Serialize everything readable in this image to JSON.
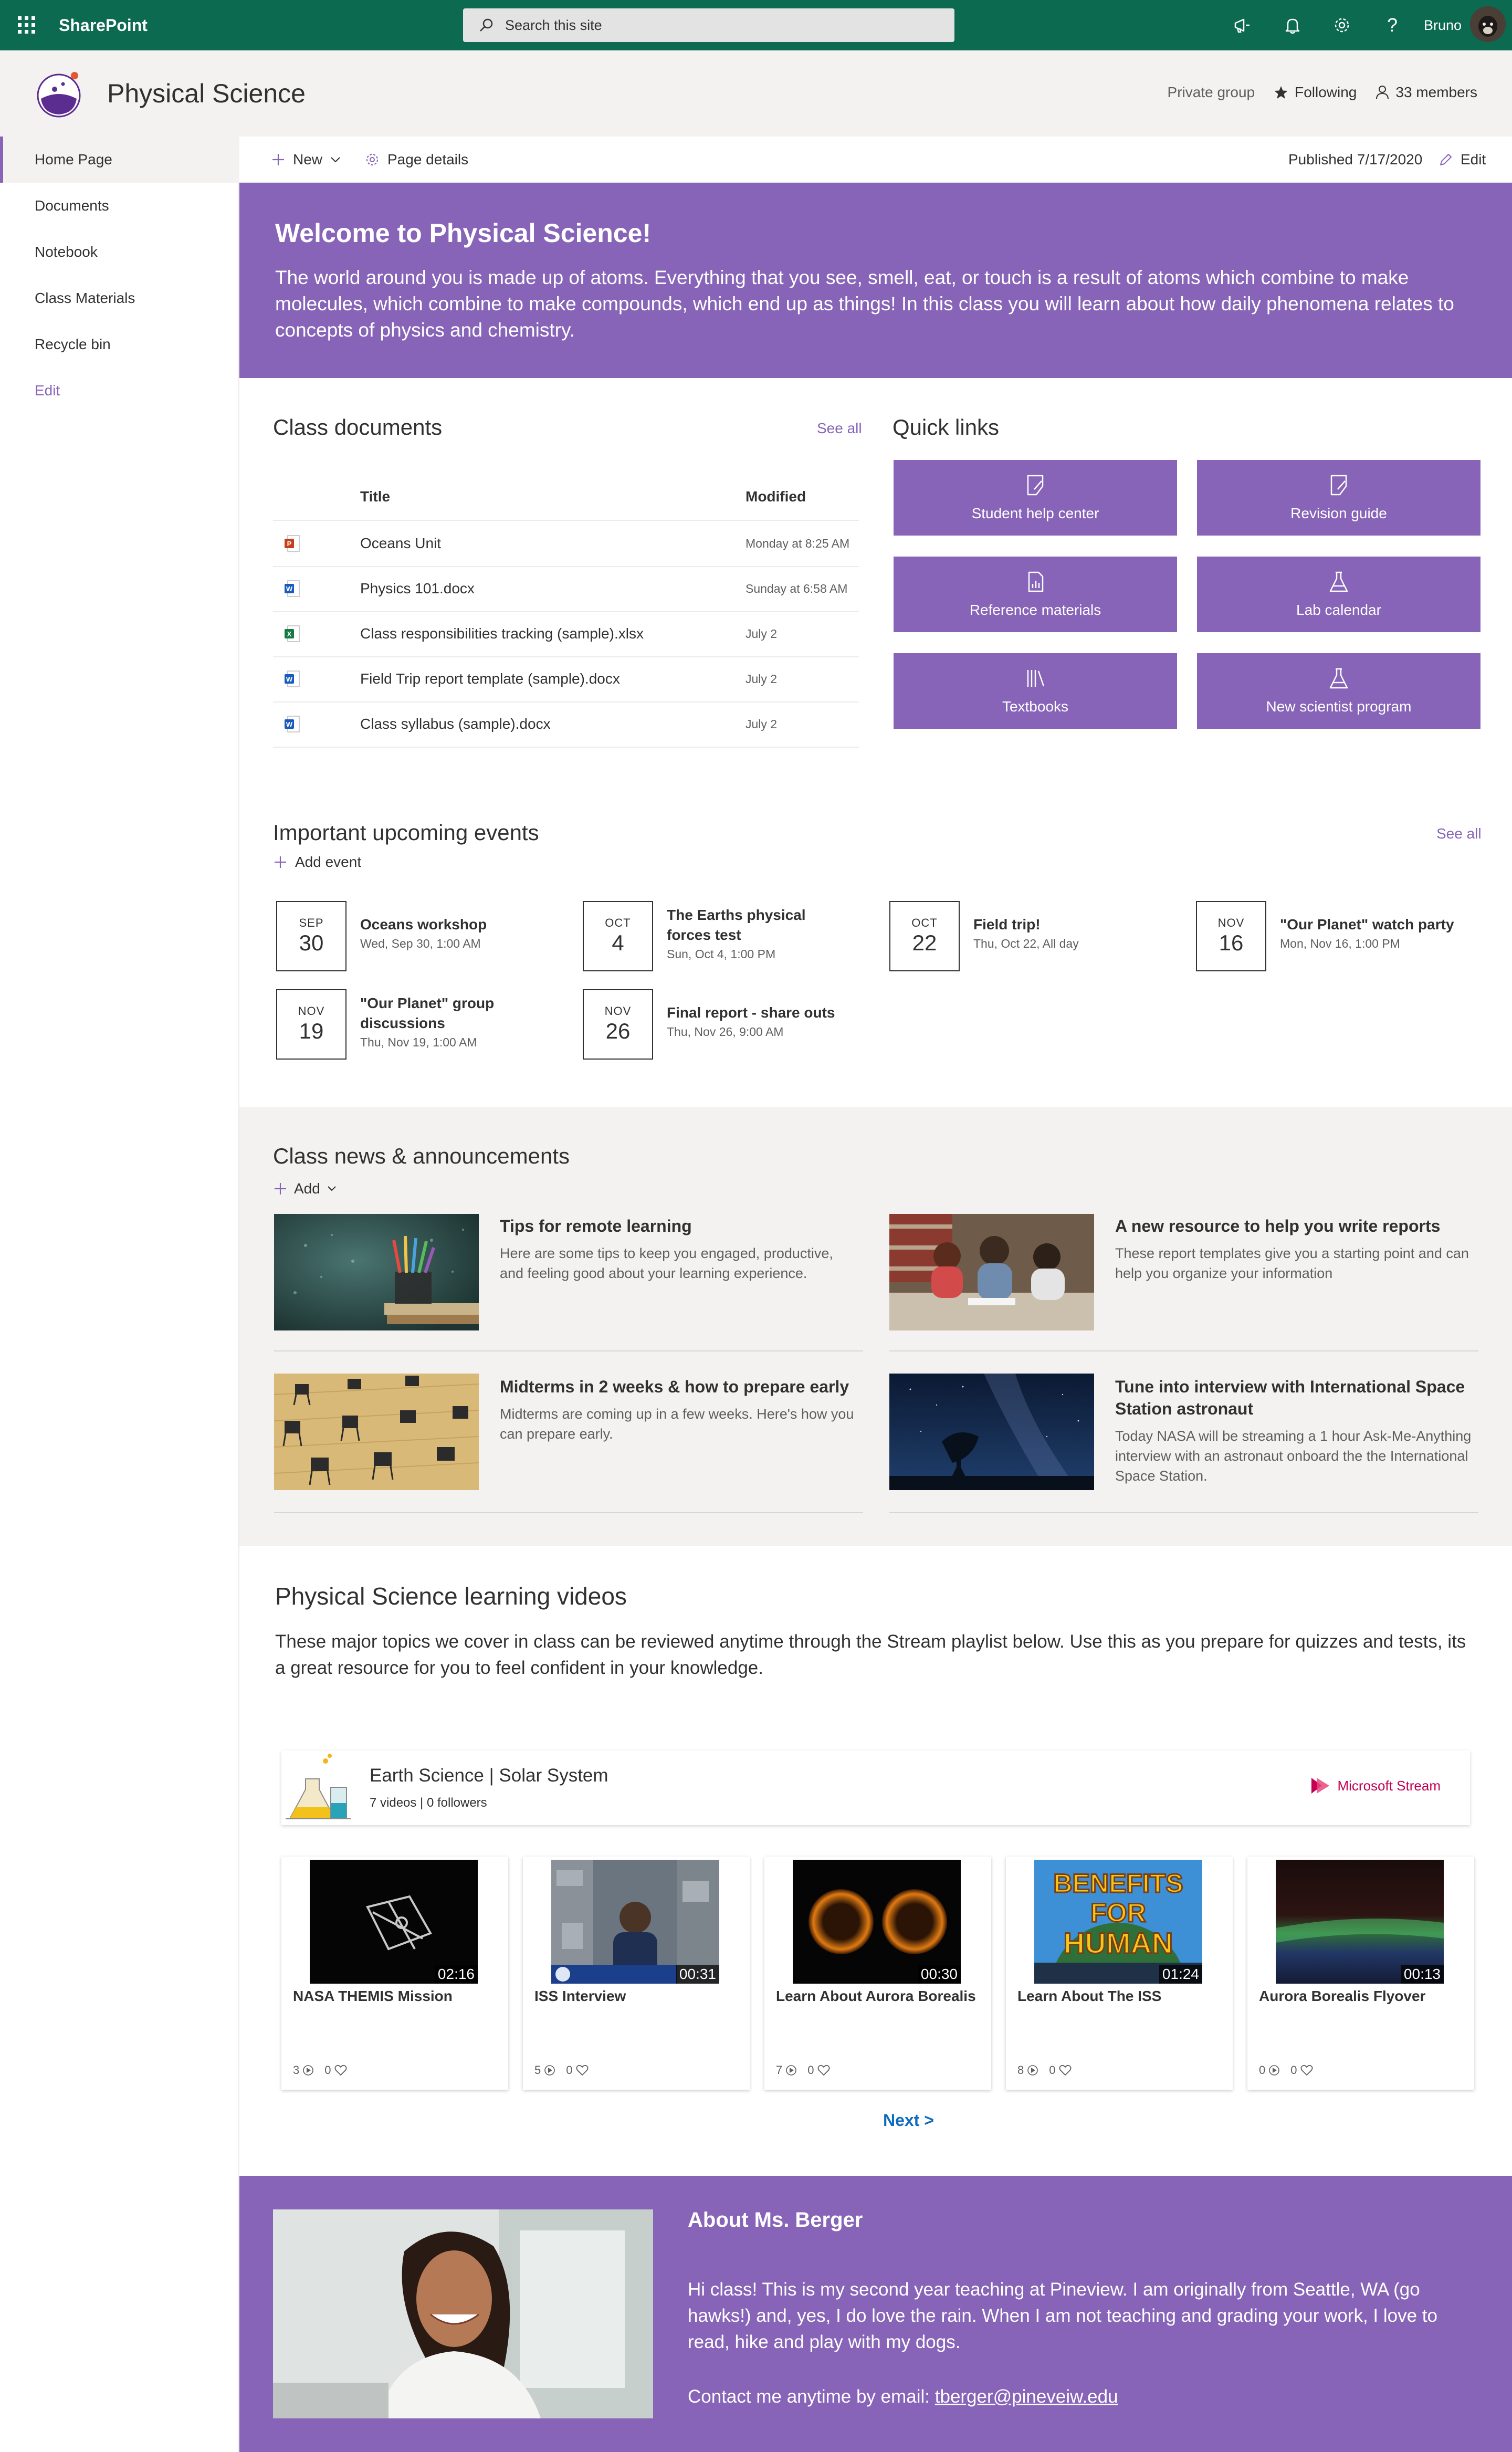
{
  "suite": {
    "app_name": "SharePoint",
    "search_placeholder": "Search this site",
    "user_name": "Bruno"
  },
  "site": {
    "title": "Physical Science",
    "privacy": "Private group",
    "following_label": "Following",
    "members_label": "33 members"
  },
  "nav": {
    "items": [
      {
        "label": "Home Page"
      },
      {
        "label": "Documents"
      },
      {
        "label": "Notebook"
      },
      {
        "label": "Class Materials"
      },
      {
        "label": "Recycle bin"
      }
    ],
    "edit_label": "Edit"
  },
  "commandbar": {
    "new_label": "New",
    "page_details_label": "Page details",
    "published_label": "Published 7/17/2020",
    "edit_label": "Edit"
  },
  "hero": {
    "title": "Welcome to Physical Science!",
    "body": "The world around you is made up of atoms. Everything that you see, smell, eat, or touch is a result of atoms which combine to make molecules, which combine to make compounds, which end up as things! In this class you will learn about how daily phenomena relates to concepts of physics and chemistry."
  },
  "documents": {
    "title": "Class documents",
    "see_all": "See all",
    "col_title": "Title",
    "col_modified": "Modified",
    "rows": [
      {
        "type": "pptx",
        "title": "Oceans Unit",
        "modified": "Monday at 8:25 AM"
      },
      {
        "type": "docx",
        "title": "Physics 101.docx",
        "modified": "Sunday at 6:58 AM"
      },
      {
        "type": "xlsx",
        "title": "Class responsibilities tracking (sample).xlsx",
        "modified": "July 2"
      },
      {
        "type": "docx",
        "title": "Field Trip report template (sample).docx",
        "modified": "July 2"
      },
      {
        "type": "docx",
        "title": "Class syllabus (sample).docx",
        "modified": "July 2"
      }
    ],
    "colors": {
      "pptx": "#c43e1c",
      "docx": "#185abd",
      "xlsx": "#107c41"
    }
  },
  "quicklinks": {
    "title": "Quick links",
    "items": [
      {
        "label": "Student help center",
        "icon": "edit-page-icon"
      },
      {
        "label": "Revision guide",
        "icon": "edit-page-icon"
      },
      {
        "label": "Reference materials",
        "icon": "report-document-icon"
      },
      {
        "label": "Lab calendar",
        "icon": "beaker-icon"
      },
      {
        "label": "Textbooks",
        "icon": "library-icon"
      },
      {
        "label": "New scientist program",
        "icon": "beaker-icon"
      }
    ]
  },
  "events": {
    "title": "Important upcoming events",
    "see_all": "See all",
    "add_label": "Add event",
    "items": [
      {
        "month": "SEP",
        "day": "30",
        "title": "Oceans workshop",
        "time": "Wed, Sep 30, 1:00 AM"
      },
      {
        "month": "OCT",
        "day": "4",
        "title": "The Earths physical forces test",
        "time": "Sun, Oct 4, 1:00 PM"
      },
      {
        "month": "OCT",
        "day": "22",
        "title": "Field trip!",
        "time": "Thu, Oct 22, All day"
      },
      {
        "month": "NOV",
        "day": "16",
        "title": "\"Our Planet\" watch party",
        "time": "Mon, Nov 16, 1:00 PM"
      },
      {
        "month": "NOV",
        "day": "19",
        "title": "\"Our Planet\" group discussions",
        "time": "Thu, Nov 19, 1:00 AM"
      },
      {
        "month": "NOV",
        "day": "26",
        "title": "Final report - share outs",
        "time": "Thu, Nov 26, 9:00 AM"
      }
    ]
  },
  "news": {
    "title": "Class news & announcements",
    "add_label": "Add",
    "items": [
      {
        "title": "Tips for remote learning",
        "desc": "Here are some tips to keep you engaged, productive, and feeling good about your learning experience."
      },
      {
        "title": "A new resource to help you write reports",
        "desc": "These report templates give you a starting point and can help you organize your information"
      },
      {
        "title": "Midterms in 2 weeks & how to prepare early",
        "desc": "Midterms are coming up in a few weeks. Here's how you can prepare early."
      },
      {
        "title": "Tune into interview with International Space Station astronaut",
        "desc": "Today NASA will be streaming a 1 hour Ask-Me-Anything interview with an astronaut onboard the the International Space Station."
      }
    ]
  },
  "videos": {
    "title": "Physical Science learning videos",
    "body": "These major topics we cover in class can be reviewed anytime through the Stream playlist below. Use this as you prepare for quizzes and tests, its a great resource for you to feel confident in your knowledge.",
    "playlist_title": "Earth Science | Solar System",
    "playlist_meta": "7 videos | 0 followers",
    "stream_label": "Microsoft Stream",
    "items": [
      {
        "title": "NASA THEMIS Mission",
        "duration": "02:16",
        "views": "3",
        "likes": "0"
      },
      {
        "title": "ISS Interview",
        "duration": "00:31",
        "views": "5",
        "likes": "0"
      },
      {
        "title": "Learn About Aurora Borealis",
        "duration": "00:30",
        "views": "7",
        "likes": "0"
      },
      {
        "title": "Learn About The ISS",
        "duration": "01:24",
        "views": "8",
        "likes": "0"
      },
      {
        "title": "Aurora Borealis Flyover",
        "duration": "00:13",
        "views": "0",
        "likes": "0"
      }
    ],
    "thumb_text_1": "BENEFITS",
    "thumb_text_2": "FOR",
    "thumb_text_3": "HUMAN",
    "next_label": "Next >"
  },
  "about": {
    "title": "About Ms. Berger",
    "body": "Hi class! This is my second year teaching at Pineview. I am originally from Seattle, WA (go hawks!) and, yes, I do love the rain. When I am not teaching and grading your work, I love to read, hike and play with my dogs.",
    "contact_prefix": "Contact me anytime by email: ",
    "email": "tberger@pineveiw.edu"
  },
  "colors": {
    "suite_bar": "#0b6a4f",
    "accent": "#8764b8",
    "link": "#0f6cbd",
    "stream": "#c30052"
  }
}
